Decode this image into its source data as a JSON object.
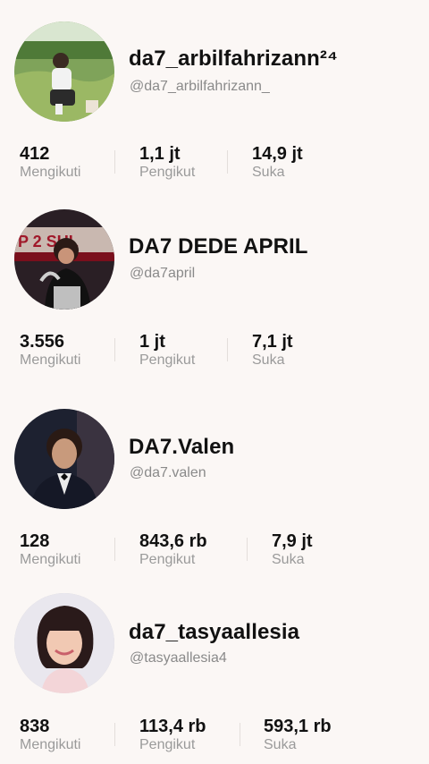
{
  "profiles": [
    {
      "name": "da7_arbilfahrizann²⁴",
      "handle": "@da7_arbilfahrizann_",
      "avatar_icon": "profile-photo-field",
      "stats": [
        {
          "value": "412",
          "label": "Mengikuti"
        },
        {
          "value": "1,1 jt",
          "label": "Pengikut"
        },
        {
          "value": "14,9 jt",
          "label": "Suka"
        }
      ]
    },
    {
      "name": "DA7 DEDE APRIL",
      "handle": "@da7april",
      "avatar_icon": "profile-photo-stage",
      "stats": [
        {
          "value": "3.556",
          "label": "Mengikuti"
        },
        {
          "value": "1 jt",
          "label": "Pengikut"
        },
        {
          "value": "7,1 jt",
          "label": "Suka"
        }
      ]
    },
    {
      "name": "DA7.Valen",
      "handle": "@da7.valen",
      "avatar_icon": "profile-photo-suit",
      "stats": [
        {
          "value": "128",
          "label": "Mengikuti"
        },
        {
          "value": "843,6 rb",
          "label": "Pengikut"
        },
        {
          "value": "7,9 jt",
          "label": "Suka"
        }
      ]
    },
    {
      "name": "da7_tasyaallesia",
      "handle": "@tasyaallesia4",
      "avatar_icon": "profile-photo-portrait",
      "stats": [
        {
          "value": "838",
          "label": "Mengikuti"
        },
        {
          "value": "113,4 rb",
          "label": "Pengikut"
        },
        {
          "value": "593,1 rb",
          "label": "Suka"
        }
      ]
    }
  ]
}
